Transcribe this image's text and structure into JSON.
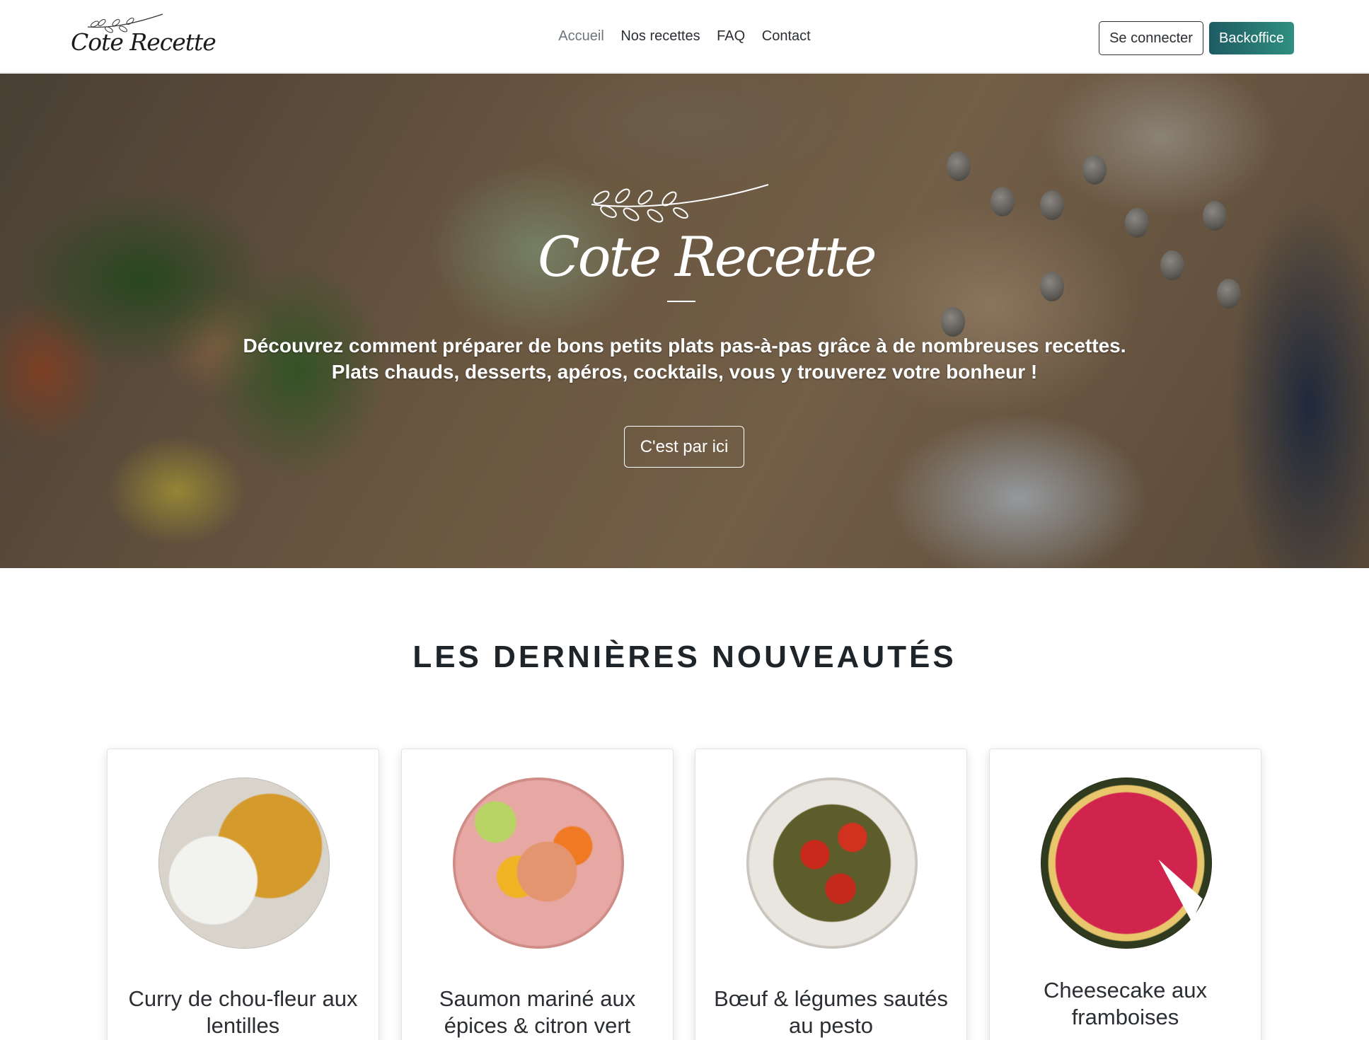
{
  "navbar": {
    "logo_text": "Cote Recette",
    "links": [
      {
        "label": "Accueil",
        "active": true
      },
      {
        "label": "Nos recettes",
        "active": false
      },
      {
        "label": "FAQ",
        "active": false
      },
      {
        "label": "Contact",
        "active": false
      }
    ],
    "login_label": "Se connecter",
    "backoffice_label": "Backoffice"
  },
  "hero": {
    "logo_text": "Cote Recette",
    "tagline_line1": "Découvrez comment préparer de bons petits plats pas-à-pas grâce à de nombreuses recettes.",
    "tagline_line2": "Plats chauds, desserts, apéros, cocktails, vous y trouverez votre bonheur !",
    "cta_label": "C'est par ici"
  },
  "latest": {
    "title": "LES DERNIÈRES NOUVEAUTÉS",
    "cards": [
      {
        "title": "Curry de chou-fleur aux lentilles"
      },
      {
        "title": "Saumon mariné aux épices & citron vert"
      },
      {
        "title": "Bœuf & légumes sautés au pesto"
      },
      {
        "title": "Cheesecake aux framboises"
      }
    ]
  },
  "colors": {
    "accent": "#2f8f80",
    "text": "#212529",
    "muted": "#6c757d"
  }
}
